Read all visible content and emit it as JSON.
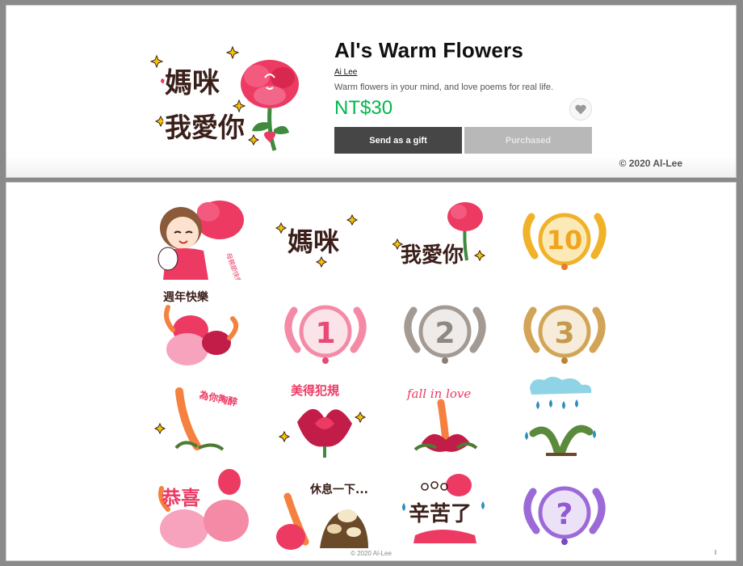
{
  "product": {
    "title": "Al's Warm Flowers",
    "author": "Ai Lee",
    "description": "Warm flowers in your mind, and love poems for real life.",
    "price": "NT$30",
    "gift_label": "Send as a gift",
    "purchased_label": "Purchased",
    "copyright": "© 2020 Al-Lee"
  },
  "main_sticker": {
    "line1": "媽咪",
    "line2": "我愛你"
  },
  "stickers": [
    {
      "name": "sticker-girl-rabbit",
      "text": "母親節快樂"
    },
    {
      "name": "sticker-mommy",
      "text": "媽咪"
    },
    {
      "name": "sticker-i-love-you",
      "text": "我愛你"
    },
    {
      "name": "sticker-number-10",
      "text": "10"
    },
    {
      "name": "sticker-anniversary",
      "text": "週年快樂"
    },
    {
      "name": "sticker-number-1",
      "text": "1"
    },
    {
      "name": "sticker-number-2",
      "text": "2"
    },
    {
      "name": "sticker-number-3",
      "text": "3"
    },
    {
      "name": "sticker-for-you",
      "text": "為你陶醉"
    },
    {
      "name": "sticker-beautiful",
      "text": "美得犯規"
    },
    {
      "name": "sticker-fall-in-love",
      "text": "fall in love"
    },
    {
      "name": "sticker-rain-plant",
      "text": ""
    },
    {
      "name": "sticker-congrats",
      "text": "恭喜"
    },
    {
      "name": "sticker-rest",
      "text": "休息一下..."
    },
    {
      "name": "sticker-hard-work",
      "text": "辛苦了"
    },
    {
      "name": "sticker-question",
      "text": "?"
    }
  ],
  "footer": {
    "copyright": "© 2020 Al-Lee"
  },
  "colors": {
    "price": "#00b84b",
    "gift_button": "#464646",
    "purchased_button": "#b8b8b8",
    "flower": "#ec3a63",
    "text_brown": "#3b1f1a"
  },
  "icons": {
    "favorite": "heart-icon"
  }
}
